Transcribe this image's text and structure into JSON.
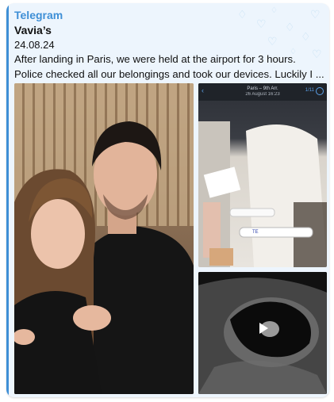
{
  "message": {
    "channel": "Telegram",
    "author": "Vavia’s",
    "date": "24.08.24",
    "text_line1": "After landing in Paris, we were held at the airport for 3 hours.",
    "text_line2": "Police checked all our belongings and took our devices. Luckily I ..."
  },
  "media": {
    "main_photo": {
      "icon": "selfie-photo"
    },
    "top_right": {
      "icon": "screenshot-photo",
      "phone_title": "Paris – 9th Arr.",
      "phone_subtitle": "26 August 16:23",
      "phone_counter": "1/11",
      "test_text": "TE"
    },
    "bottom_right": {
      "icon": "ultrasound-video",
      "play_icon": "play-icon"
    }
  },
  "colors": {
    "accent": "#3e8fd6",
    "bubble_bg": "#edf5fd",
    "pattern": "#c3dff3"
  }
}
